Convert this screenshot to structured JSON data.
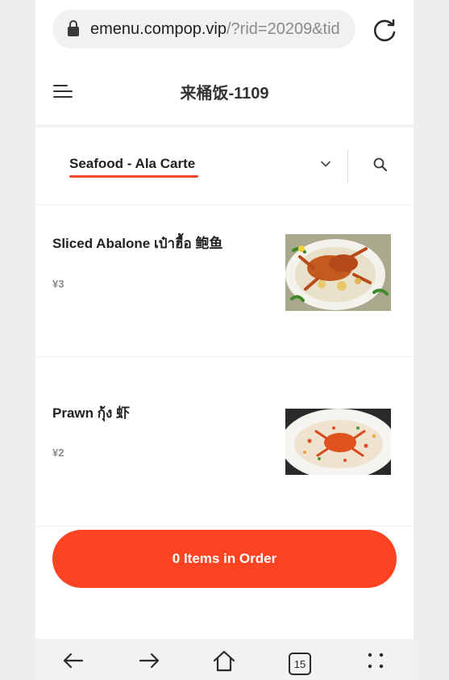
{
  "browser": {
    "url_host": "emenu.compop.vip",
    "url_path": "/?rid=20209&tid",
    "tab_count": "15"
  },
  "header": {
    "title": "来桶饭-1109"
  },
  "category": {
    "label": "Seafood - Ala Carte"
  },
  "items": [
    {
      "name": "Sliced Abalone เป๋าฮื้อ 鲍鱼",
      "price": "¥3"
    },
    {
      "name": "Prawn กุ้ง 虾",
      "price": "¥2"
    }
  ],
  "order": {
    "label": "0 Items in Order"
  },
  "colors": {
    "accent": "#fc4423",
    "underline": "#f24b2a"
  },
  "icons": {
    "lock": "lock-icon",
    "reload": "reload-icon",
    "menu": "hamburger-menu-icon",
    "chevron": "chevron-down-icon",
    "search": "search-icon",
    "back": "back-arrow-icon",
    "forward": "forward-arrow-icon",
    "home": "home-icon",
    "tabs": "tabs-icon",
    "more": "more-options-icon"
  }
}
